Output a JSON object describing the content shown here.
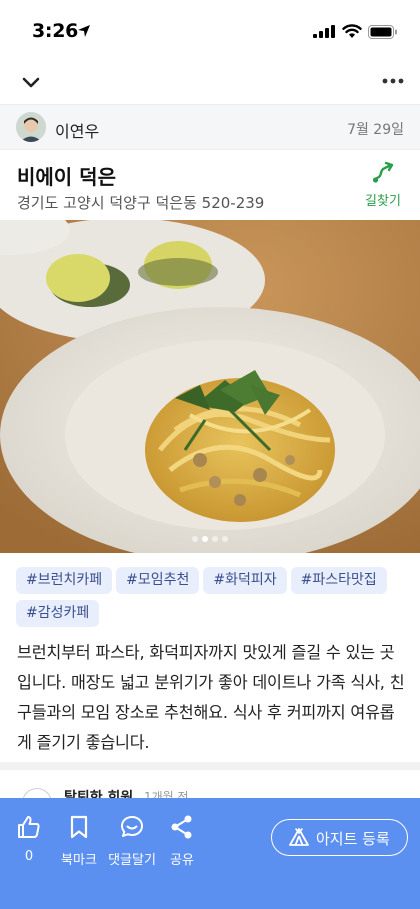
{
  "status_bar": {
    "time": "3:26"
  },
  "author": {
    "name": "이연우",
    "date": "7월 29일"
  },
  "place": {
    "name": "비에이 덕은",
    "address": "경기도 고양시 덕양구 덕은동 520-239",
    "directions_label": "길찾기",
    "accent_color": "#2a9d4a"
  },
  "photo": {
    "subject": "pasta dish photo",
    "dot_count": 4,
    "active_dot": 2
  },
  "tags": [
    "#브런치카페",
    "#모임추천",
    "#화덕피자",
    "#파스타맛집",
    "#감성카페"
  ],
  "description": "브런치부터 파스타, 화덕피자까지 맛있게 즐길 수 있는 곳입니다. 매장도 넓고 분위기가 좋아 데이트나 가족 식사, 친구들과의 모임 장소로 추천해요. 식사 후 커피까지 여유롭게 즐기기 좋습니다.",
  "comment": {
    "author": "탈퇴한 회원",
    "time": "1개월 전"
  },
  "bottom_bar": {
    "like_count": "0",
    "bookmark_label": "북마크",
    "comment_label": "댓글달기",
    "share_label": "공유",
    "register_label": "아지트 등록",
    "bar_color": "#5b8ff0"
  }
}
